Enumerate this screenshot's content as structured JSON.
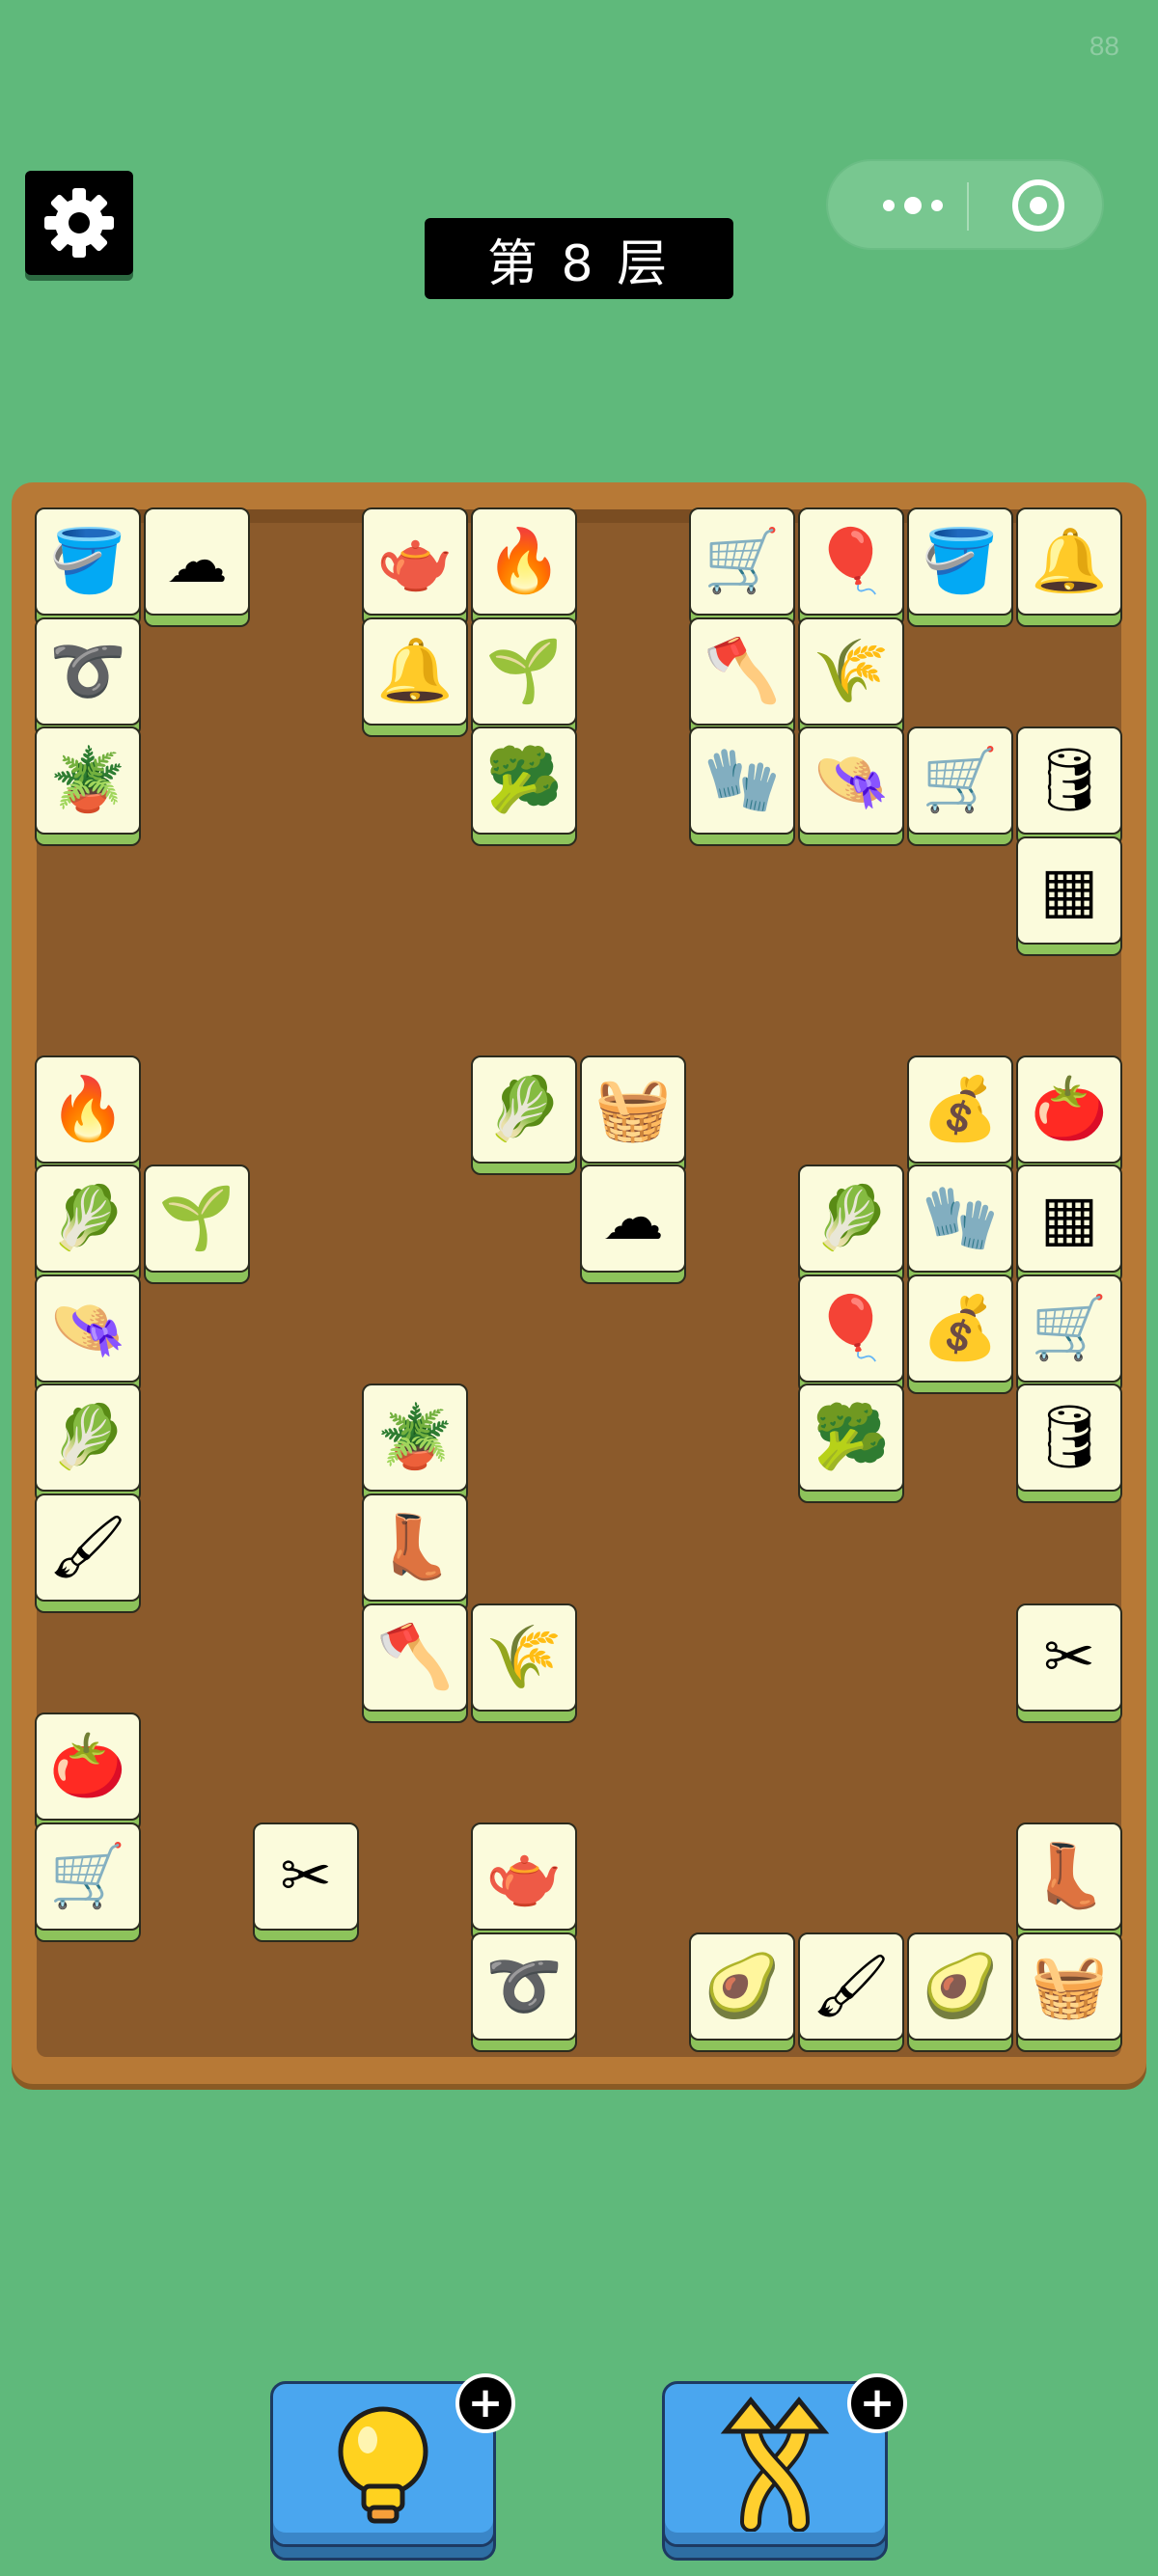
{
  "status": {
    "fps": "88"
  },
  "header": {
    "level_label": "第 8 层"
  },
  "colors": {
    "background": "#5fb97b",
    "board": "#8b5a2b",
    "tile_face": "#fbfbdc",
    "tile_base": "#8dc35b"
  },
  "icons": {
    "settings": "gear-icon",
    "more": "more-dots-icon",
    "close": "target-circle-icon",
    "hint": "lightbulb-icon",
    "shuffle": "shuffle-arrows-icon"
  },
  "tiles": [
    {
      "name": "bucket",
      "glyph": "🪣"
    },
    {
      "name": "cotton",
      "glyph": "☁"
    },
    {
      "name": "watering-can",
      "glyph": "🫖"
    },
    {
      "name": "campfire",
      "glyph": "🔥"
    },
    {
      "name": "cart",
      "glyph": "🛒"
    },
    {
      "name": "balloon",
      "glyph": "🎈"
    },
    {
      "name": "bucket",
      "glyph": "🪣"
    },
    {
      "name": "bell",
      "glyph": "🔔"
    },
    {
      "name": "hose",
      "glyph": "➰"
    },
    {
      "name": "bell",
      "glyph": "🔔"
    },
    {
      "name": "seed-bag",
      "glyph": "🌱"
    },
    {
      "name": "axe",
      "glyph": "🪓"
    },
    {
      "name": "wheat",
      "glyph": "🌾"
    },
    {
      "name": "plant-pot",
      "glyph": "🪴"
    },
    {
      "name": "broccoli",
      "glyph": "🥦"
    },
    {
      "name": "glove",
      "glyph": "🧤"
    },
    {
      "name": "straw-hat",
      "glyph": "👒"
    },
    {
      "name": "cart",
      "glyph": "🛒"
    },
    {
      "name": "barrel",
      "glyph": "🛢"
    },
    {
      "name": "fence",
      "glyph": "▦"
    },
    {
      "name": "campfire",
      "glyph": "🔥"
    },
    {
      "name": "cabbage",
      "glyph": "🥬"
    },
    {
      "name": "basket",
      "glyph": "🧺"
    },
    {
      "name": "sack",
      "glyph": "💰"
    },
    {
      "name": "tomato",
      "glyph": "🍅"
    },
    {
      "name": "cabbage",
      "glyph": "🥬"
    },
    {
      "name": "seed-bag",
      "glyph": "🌱"
    },
    {
      "name": "cotton",
      "glyph": "☁"
    },
    {
      "name": "cabbage",
      "glyph": "🥬"
    },
    {
      "name": "glove",
      "glyph": "🧤"
    },
    {
      "name": "fence",
      "glyph": "▦"
    },
    {
      "name": "straw-hat",
      "glyph": "👒"
    },
    {
      "name": "balloon",
      "glyph": "🎈"
    },
    {
      "name": "sack",
      "glyph": "💰"
    },
    {
      "name": "cart",
      "glyph": "🛒"
    },
    {
      "name": "cabbage",
      "glyph": "🥬"
    },
    {
      "name": "plant-pot",
      "glyph": "🪴"
    },
    {
      "name": "broccoli",
      "glyph": "🥦"
    },
    {
      "name": "barrel",
      "glyph": "🛢"
    },
    {
      "name": "brush",
      "glyph": "🖌"
    },
    {
      "name": "boot",
      "glyph": "👢"
    },
    {
      "name": "axe",
      "glyph": "🪓"
    },
    {
      "name": "wheat",
      "glyph": "🌾"
    },
    {
      "name": "shears",
      "glyph": "✂"
    },
    {
      "name": "tomato",
      "glyph": "🍅"
    },
    {
      "name": "cart",
      "glyph": "🛒"
    },
    {
      "name": "shears",
      "glyph": "✂"
    },
    {
      "name": "watering-can",
      "glyph": "🫖"
    },
    {
      "name": "boot",
      "glyph": "👢"
    },
    {
      "name": "hose",
      "glyph": "➰"
    },
    {
      "name": "avocado",
      "glyph": "🥑"
    },
    {
      "name": "brush",
      "glyph": "🖌"
    },
    {
      "name": "avocado",
      "glyph": "🥑"
    },
    {
      "name": "basket",
      "glyph": "🧺"
    }
  ],
  "tools": [
    {
      "name": "hint",
      "icon": "lightbulb-icon",
      "glyph": "💡",
      "badge": "+"
    },
    {
      "name": "shuffle",
      "icon": "shuffle-arrows-icon",
      "glyph": "⤮",
      "badge": "+"
    }
  ]
}
